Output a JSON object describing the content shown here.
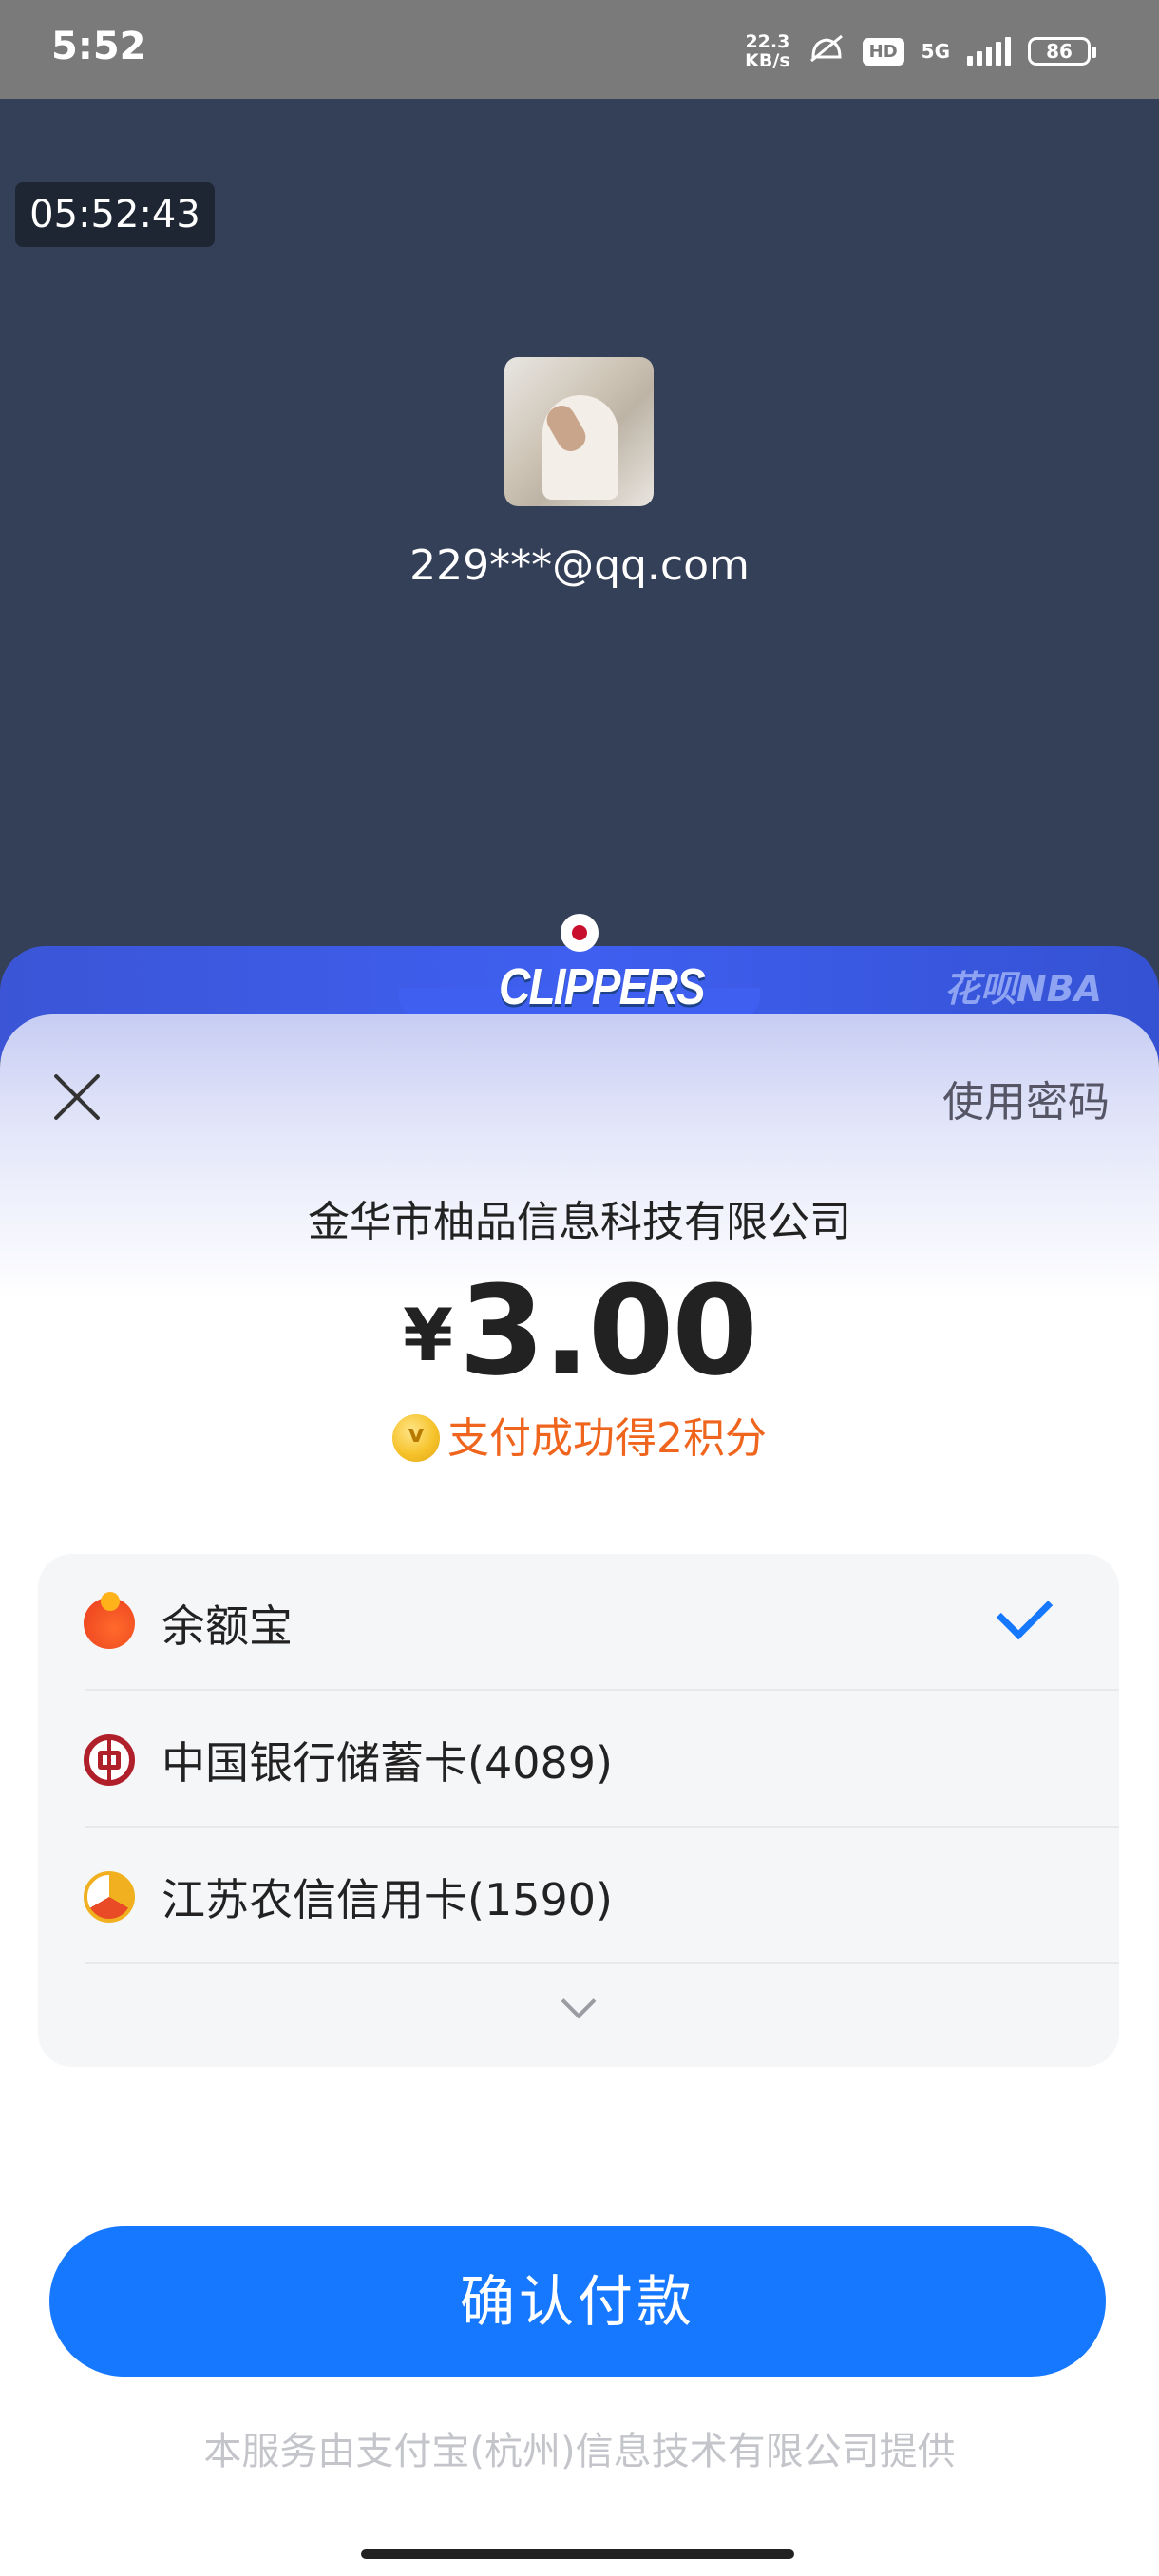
{
  "status_bar": {
    "time": "5:52",
    "net_speed_value": "22.3",
    "net_speed_unit": "KB/s",
    "hd_label": "HD",
    "network": "5G",
    "battery": "86"
  },
  "screen_recorder": {
    "timer": "05:52:43"
  },
  "payee": {
    "account": "229***@qq.com"
  },
  "banner": {
    "brand": "CLIPPERS",
    "promo": "花呗NBA"
  },
  "sheet": {
    "use_password": "使用密码",
    "merchant": "金华市柚品信息科技有限公司",
    "currency": "¥",
    "amount": "3.00",
    "reward": "支付成功得2积分",
    "methods": [
      {
        "label": "余额宝",
        "icon": "yuebao-icon",
        "selected": true
      },
      {
        "label": "中国银行储蓄卡(4089)",
        "icon": "bank-of-china-icon",
        "selected": false
      },
      {
        "label": "江苏农信信用卡(1590)",
        "icon": "jiangsu-rural-credit-icon",
        "selected": false
      }
    ],
    "confirm_label": "确认付款",
    "footer": "本服务由支付宝(杭州)信息技术有限公司提供"
  },
  "colors": {
    "primary": "#1677ff",
    "reward": "#f0651e",
    "banner": "#3e5ff0",
    "background": "#344057"
  }
}
